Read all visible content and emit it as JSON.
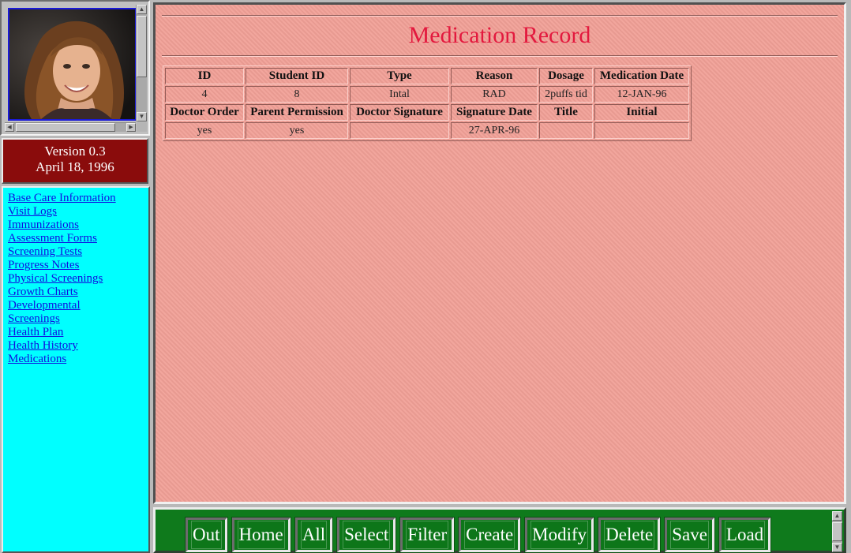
{
  "version": {
    "line1": "Version 0.3",
    "line2": "April 18, 1996"
  },
  "nav": {
    "links": [
      "Base Care Information",
      "Visit Logs",
      "Immunizations",
      "Assessment Forms",
      "Screening Tests",
      "Progress Notes",
      "Physical Screenings",
      "Growth Charts",
      "Developmental Screenings",
      "Health Plan",
      "Health History",
      "Medications"
    ]
  },
  "main": {
    "title": "Medication Record",
    "table": {
      "header1": [
        "ID",
        "Student ID",
        "Type",
        "Reason",
        "Dosage",
        "Medication Date"
      ],
      "row1": [
        "4",
        "8",
        "Intal",
        "RAD",
        "2puffs tid",
        "12-JAN-96"
      ],
      "header2": [
        "Doctor Order",
        "Parent Permission",
        "Doctor Signature",
        "Signature Date",
        "Title",
        "Initial"
      ],
      "row2": [
        "yes",
        "yes",
        "",
        "27-APR-96",
        "",
        ""
      ]
    }
  },
  "toolbar": {
    "buttons": [
      "Out",
      "Home",
      "All",
      "Select",
      "Filter",
      "Create",
      "Modify",
      "Delete",
      "Save",
      "Load"
    ]
  },
  "colors": {
    "version_bg": "#8a0c0c",
    "nav_bg": "#00ffff",
    "main_bg": "#f1a097",
    "title": "#e3193e",
    "toolbar_bg": "#0f7a1c",
    "link": "#1010e0"
  }
}
